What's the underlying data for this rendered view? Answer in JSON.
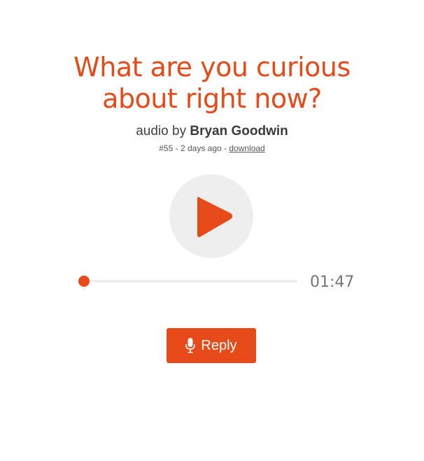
{
  "post": {
    "title_line1": "What are you curious",
    "title_line2": "about right now?",
    "byline_prefix": "audio by",
    "author": "Bryan Goodwin",
    "number": "#55",
    "age": "2 days ago",
    "download_label": "download"
  },
  "player": {
    "play_icon": "play-icon",
    "progress": 0.0,
    "duration": "01:47"
  },
  "actions": {
    "reply_label": "Reply",
    "reply_icon": "microphone-icon"
  },
  "colors": {
    "accent": "#e64a19",
    "button_bg": "#eeeeee",
    "track": "#eeeeee",
    "text": "#424242"
  }
}
